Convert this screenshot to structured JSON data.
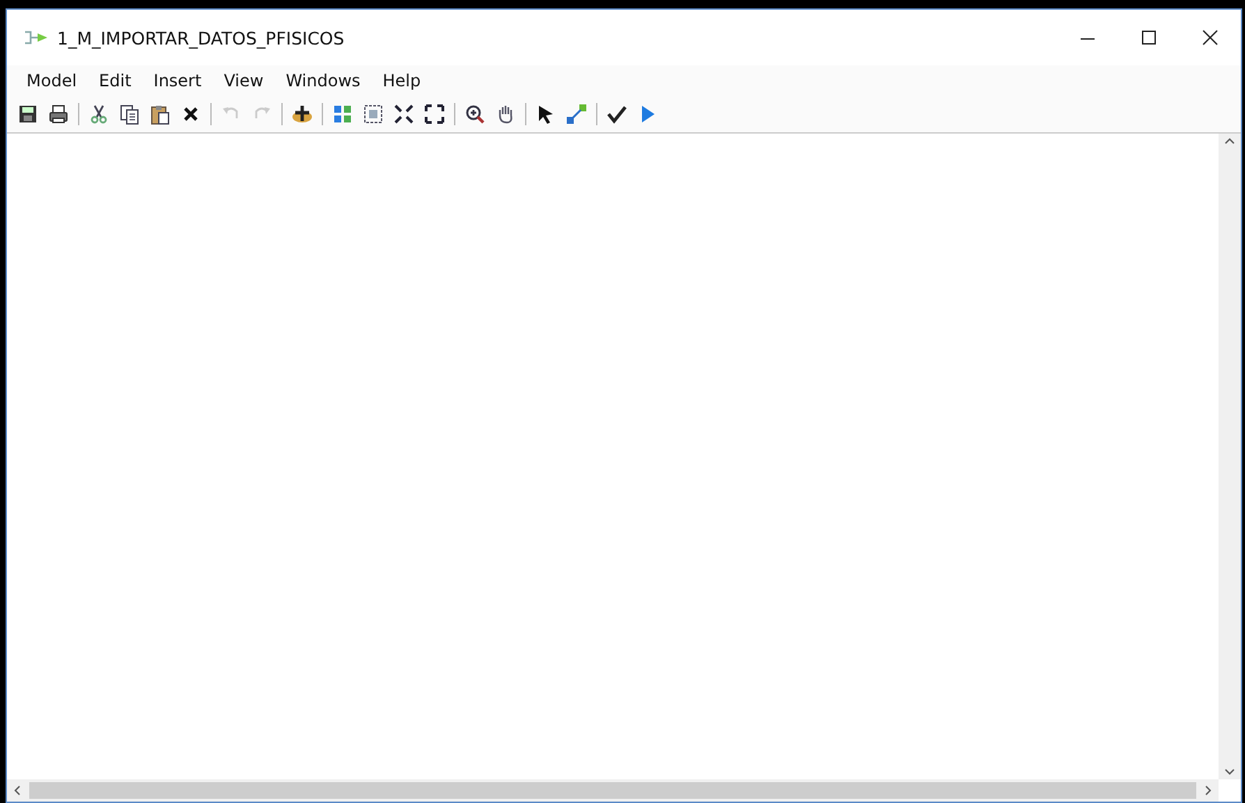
{
  "window": {
    "title": "1_M_IMPORTAR_DATOS_PFISICOS"
  },
  "menu": [
    "Model",
    "Edit",
    "Insert",
    "View",
    "Windows",
    "Help"
  ],
  "toolbar": [
    {
      "kind": "save",
      "disabled": false
    },
    {
      "kind": "print",
      "disabled": false
    },
    {
      "kind": "separator"
    },
    {
      "kind": "cut",
      "disabled": false
    },
    {
      "kind": "copy",
      "disabled": false
    },
    {
      "kind": "paste",
      "disabled": false
    },
    {
      "kind": "delete",
      "disabled": false
    },
    {
      "kind": "separator"
    },
    {
      "kind": "undo",
      "disabled": true
    },
    {
      "kind": "redo",
      "disabled": true
    },
    {
      "kind": "separator"
    },
    {
      "kind": "add",
      "disabled": false
    },
    {
      "kind": "separator"
    },
    {
      "kind": "grid",
      "disabled": false
    },
    {
      "kind": "fit",
      "disabled": false
    },
    {
      "kind": "shrink",
      "disabled": false
    },
    {
      "kind": "expand",
      "disabled": false
    },
    {
      "kind": "separator"
    },
    {
      "kind": "zoom",
      "disabled": false
    },
    {
      "kind": "pan",
      "disabled": false
    },
    {
      "kind": "separator"
    },
    {
      "kind": "select",
      "disabled": false
    },
    {
      "kind": "connect",
      "disabled": false
    },
    {
      "kind": "separator"
    },
    {
      "kind": "validate",
      "disabled": false
    },
    {
      "kind": "run",
      "disabled": false
    }
  ]
}
